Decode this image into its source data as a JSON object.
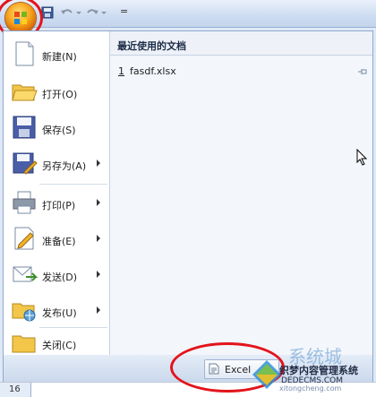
{
  "qat": {
    "separator": "=",
    "icons": [
      "office-button-icon",
      "save-icon",
      "undo-icon",
      "redo-icon",
      "customize-qat-icon"
    ]
  },
  "commands": [
    {
      "label": "新建(N)",
      "icon": "new-document-icon",
      "has_submenu": false
    },
    {
      "label": "打开(O)",
      "icon": "open-folder-icon",
      "has_submenu": false
    },
    {
      "label": "保存(S)",
      "icon": "save-icon",
      "has_submenu": false
    },
    {
      "label": "另存为(A)",
      "icon": "save-as-icon",
      "has_submenu": true
    },
    {
      "label": "打印(P)",
      "icon": "printer-icon",
      "has_submenu": true
    },
    {
      "label": "准备(E)",
      "icon": "prepare-icon",
      "has_submenu": true
    },
    {
      "label": "发送(D)",
      "icon": "send-icon",
      "has_submenu": true
    },
    {
      "label": "发布(U)",
      "icon": "publish-icon",
      "has_submenu": true
    },
    {
      "label": "关闭(C)",
      "icon": "close-folder-icon",
      "has_submenu": false
    }
  ],
  "recent": {
    "title": "最近使用的文档",
    "items": [
      {
        "number": "1",
        "name": "fasdf.xlsx"
      }
    ]
  },
  "bottom": {
    "excel_options_label": "Excel"
  },
  "sheet": {
    "row_number": "16"
  },
  "watermark": {
    "big": "系统城",
    "line1": "织梦内容管理系统",
    "line2": "DEDECMS.COM",
    "sub": "xitongcheng.com"
  },
  "colors": {
    "accent_red": "#e3141b",
    "office_orange": "#f7a21a",
    "ribbon_blue": "#dfe8f6"
  }
}
